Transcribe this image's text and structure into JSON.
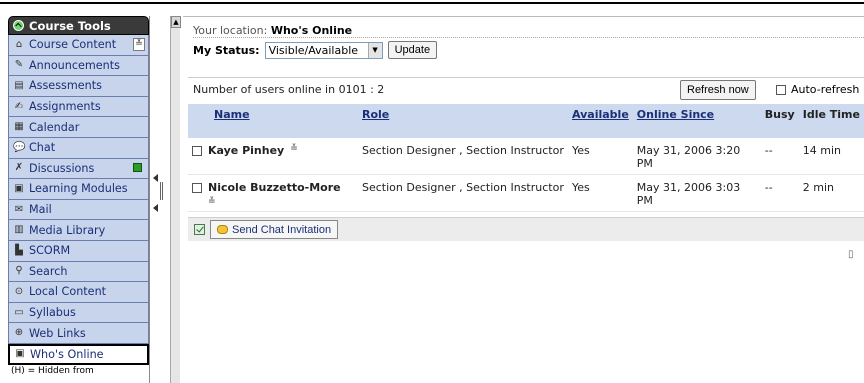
{
  "sidebar": {
    "title": "Course Tools",
    "items": [
      {
        "label": "Course Content",
        "icon": "home-icon",
        "glyph": "⌂"
      },
      {
        "label": "Announcements",
        "icon": "announcement-icon",
        "glyph": "✎"
      },
      {
        "label": "Assessments",
        "icon": "assessment-icon",
        "glyph": "▤"
      },
      {
        "label": "Assignments",
        "icon": "assignment-icon",
        "glyph": "✍"
      },
      {
        "label": "Calendar",
        "icon": "calendar-icon",
        "glyph": "▦"
      },
      {
        "label": "Chat",
        "icon": "chat-icon",
        "glyph": "💬"
      },
      {
        "label": "Discussions",
        "icon": "discussion-icon",
        "glyph": "✗"
      },
      {
        "label": "Learning Modules",
        "icon": "module-icon",
        "glyph": "▣"
      },
      {
        "label": "Mail",
        "icon": "mail-icon",
        "glyph": "✉"
      },
      {
        "label": "Media Library",
        "icon": "media-library-icon",
        "glyph": "▥"
      },
      {
        "label": "SCORM",
        "icon": "scorm-icon",
        "glyph": "▙"
      },
      {
        "label": "Search",
        "icon": "search-icon",
        "glyph": "⚲"
      },
      {
        "label": "Local Content",
        "icon": "local-content-icon",
        "glyph": "⊙"
      },
      {
        "label": "Syllabus",
        "icon": "syllabus-icon",
        "glyph": "▭"
      },
      {
        "label": "Web Links",
        "icon": "web-links-icon",
        "glyph": "⊕"
      },
      {
        "label": "Who's Online",
        "icon": "whos-online-icon",
        "glyph": "▣"
      }
    ],
    "footnote": "(H) = Hidden from"
  },
  "location": {
    "prefix": "Your location:",
    "page": "Who's Online"
  },
  "status": {
    "label": "My Status:",
    "selected": "Visible/Available",
    "update_label": "Update"
  },
  "online": {
    "count_text": "Number of users online in 0101 : 2",
    "refresh_label": "Refresh now",
    "autorefresh_label": "Auto-refresh"
  },
  "table": {
    "headers": {
      "name": "Name",
      "role": "Role",
      "available": "Available",
      "online_since": "Online Since",
      "busy": "Busy",
      "idle": "Idle Time"
    },
    "rows": [
      {
        "name": "Kaye Pinhey",
        "role": "Section Designer , Section Instructor",
        "available": "Yes",
        "online_since": "May 31, 2006 3:20 PM",
        "busy": "--",
        "idle": "14 min"
      },
      {
        "name": "Nicole Buzzetto-More",
        "role": "Section Designer , Section Instructor",
        "available": "Yes",
        "online_since": "May 31, 2006 3:03 PM",
        "busy": "--",
        "idle": "2 min"
      }
    ]
  },
  "actions": {
    "chat_label": "Send Chat Invitation"
  },
  "colors": {
    "header_bg": "#cdd9ef",
    "sidebar_bg": "#c7d4ec",
    "link": "#1b2f77"
  }
}
